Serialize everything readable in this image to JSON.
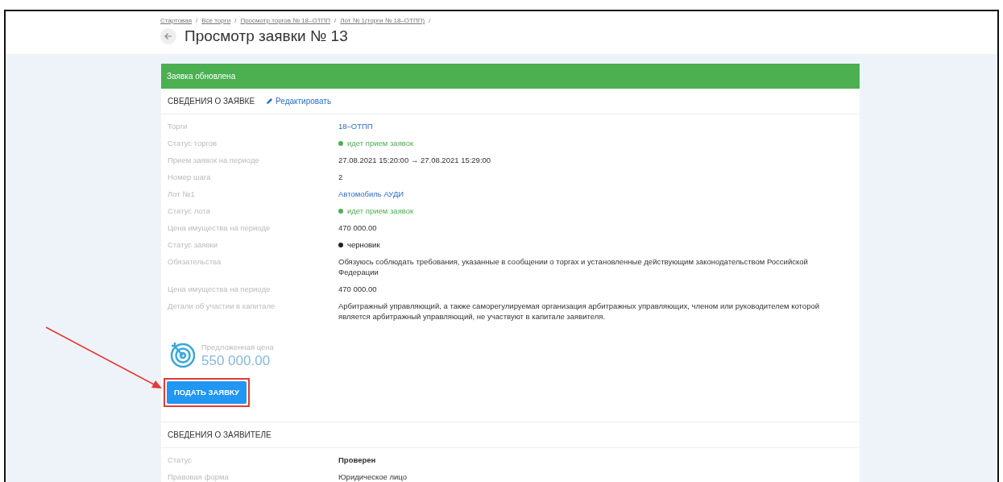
{
  "breadcrumbs": [
    "Стартовая",
    "Все торги",
    "Просмотр торгов № 18–ОТПП",
    "Лот № 1(торги № 18–ОТПП)"
  ],
  "breadcrumb_separator": "/",
  "page_title": "Просмотр заявки № 13",
  "alert": "Заявка обновлена",
  "application": {
    "heading": "СВЕДЕНИЯ О ЗАЯВКЕ",
    "edit_link": "Редактировать",
    "rows": [
      {
        "label": "Торги",
        "value": "18–ОТПП",
        "kind": "link"
      },
      {
        "label": "Статус торгов",
        "value": "идет прием заявок",
        "kind": "status",
        "color": "#4caf50"
      },
      {
        "label": "Прием заявок на периоде",
        "value": "27.08.2021 15:20:00 → 27.08.2021 15:29:00",
        "kind": "text"
      },
      {
        "label": "Номер шага",
        "value": "2",
        "kind": "text"
      },
      {
        "label": "Лот №1",
        "value": "Автомобиль АУДИ",
        "kind": "link"
      },
      {
        "label": "Статус лота",
        "value": "идет прием заявок",
        "kind": "status",
        "color": "#4caf50"
      },
      {
        "label": "Цена имущества на периоде",
        "value": "470 000.00",
        "kind": "text"
      },
      {
        "label": "Статус заявки",
        "value": "черновик",
        "kind": "status",
        "color": "#212121"
      },
      {
        "label": "Обязательства",
        "value": "Обязуюсь соблюдать требования, указанные в сообщении о торгах и установленные действующим законодательством Российской Федерации",
        "kind": "text"
      },
      {
        "label": "Цена имущества на периоде",
        "value": "470 000.00",
        "kind": "text"
      },
      {
        "label": "Детали об участии в капитале",
        "value": "Арбитражный управляющий, а также саморегулируемая организация арбитражных управляющих, членом или руководителем которой является арбитражный управляющий, не участвуют в капитале заявителя.",
        "kind": "text"
      }
    ],
    "offer_label": "Предложенная цена",
    "offer_value": "550 000.00",
    "submit": "ПОДАТЬ ЗАЯВКУ",
    "submit_highlighted": true
  },
  "applicant": {
    "heading": "СВЕДЕНИЯ О ЗАЯВИТЕЛЕ",
    "rows": [
      {
        "label": "Статус",
        "value": "Проверен",
        "kind": "bold"
      },
      {
        "label": "Правовая форма",
        "value": "Юридическое лицо",
        "kind": "text"
      }
    ]
  }
}
